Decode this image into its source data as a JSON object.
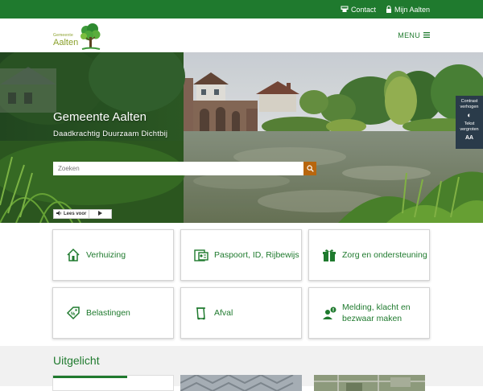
{
  "topbar": {
    "contact_label": "Contact",
    "account_label": "Mijn Aalten"
  },
  "header": {
    "logo_small": "Gemeente",
    "logo_big": "Aalten",
    "menu_label": "MENU"
  },
  "hero": {
    "title": "Gemeente Aalten",
    "subtitle": "Daadkrachtig Duurzaam Dichtbij",
    "search_placeholder": "Zoeken",
    "readspeaker_label": "Lees voor"
  },
  "accessibility": {
    "contrast_label": "Contrast verhogen",
    "text_label": "Tekst vergroten",
    "text_icon": "AA"
  },
  "tiles": [
    {
      "label": "Verhuizing",
      "icon": "house-icon"
    },
    {
      "label": "Paspoort, ID, Rijbewijs",
      "icon": "id-card-icon"
    },
    {
      "label": "Zorg en ondersteuning",
      "icon": "gift-care-icon"
    },
    {
      "label": "Belastingen",
      "icon": "tax-tag-icon"
    },
    {
      "label": "Afval",
      "icon": "trash-bin-icon"
    },
    {
      "label": "Melding, klacht en bezwaar maken",
      "icon": "person-alert-icon"
    }
  ],
  "featured": {
    "heading": "Uitgelicht"
  },
  "colors": {
    "brand_green": "#1f7a2e",
    "logo_green": "#8aa02a",
    "search_button": "#b8660e",
    "a11y_panel": "#2a3b4a"
  }
}
